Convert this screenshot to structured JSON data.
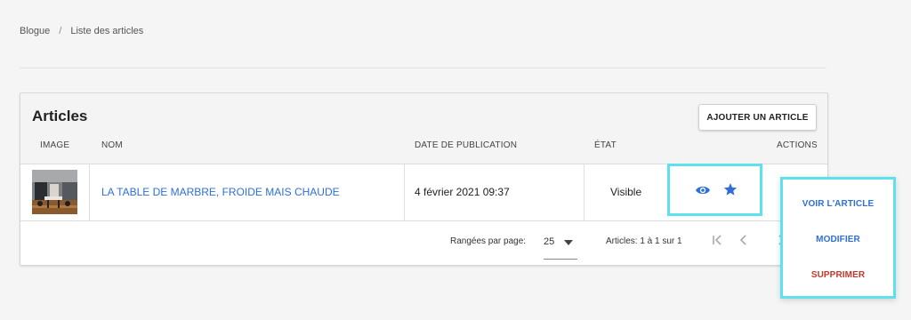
{
  "breadcrumb": {
    "root": "Blogue",
    "separator": "/",
    "current": "Liste des articles"
  },
  "card": {
    "title": "Articles",
    "add_button": "AJOUTER UN ARTICLE"
  },
  "table": {
    "headers": {
      "image": "IMAGE",
      "name": "NOM",
      "date": "DATE DE PUBLICATION",
      "state": "ÉTAT",
      "actions": "ACTIONS"
    },
    "rows": [
      {
        "title": "LA TABLE DE MARBRE, FROIDE MAIS CHAUDE",
        "date": "4 février 2021 09:37",
        "state": "Visible"
      }
    ]
  },
  "pagination": {
    "rows_per_page_label": "Rangées par page:",
    "rows_per_page_value": "25",
    "range_text": "Articles: 1 à 1 sur 1"
  },
  "menu": {
    "view": "VOIR L'ARTICLE",
    "edit": "MODIFIER",
    "delete": "SUPPRIMER"
  },
  "colors": {
    "link": "#2f6fd8",
    "danger": "#c0392b",
    "highlight": "#5fe0ef"
  },
  "icons": [
    "eye-icon",
    "star-icon",
    "first-page-icon",
    "prev-page-icon",
    "next-page-icon",
    "dropdown-arrow-icon"
  ]
}
